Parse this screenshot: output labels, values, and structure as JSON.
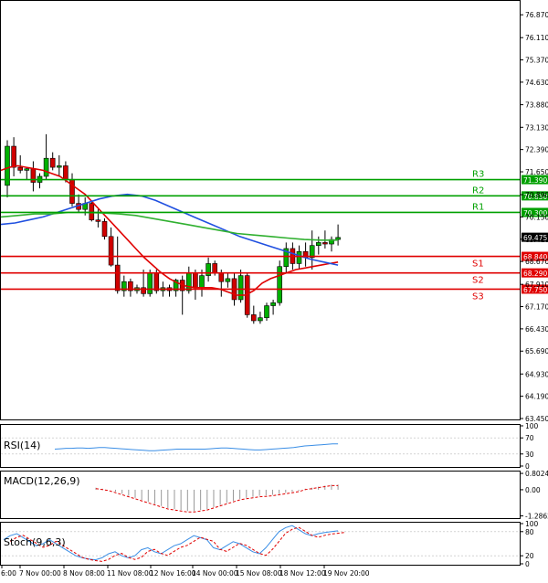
{
  "chart_data": [
    {
      "type": "candlestick",
      "panel": "price",
      "y_ticks": [
        76.87,
        76.11,
        75.37,
        74.63,
        73.88,
        73.13,
        72.39,
        71.65,
        70.89,
        70.15,
        69.41,
        68.67,
        67.91,
        67.17,
        66.43,
        65.69,
        64.93,
        64.19,
        63.45
      ],
      "ylim": [
        63.45,
        77.3
      ],
      "x_labels": [
        "6:00",
        "7 Nov 00:00",
        "8 Nov 08:00",
        "11 Nov 08:00",
        "12 Nov 16:00",
        "14 Nov 00:00",
        "15 Nov 08:00",
        "18 Nov 12:00",
        "19 Nov 20:00"
      ],
      "candles": [
        [
          71.2,
          72.7,
          70.8,
          72.5
        ],
        [
          72.5,
          72.8,
          71.5,
          71.8
        ],
        [
          71.8,
          72.2,
          71.6,
          71.7
        ],
        [
          71.7,
          71.8,
          71.4,
          71.75
        ],
        [
          71.75,
          72.0,
          71.0,
          71.3
        ],
        [
          71.3,
          71.6,
          71.1,
          71.5
        ],
        [
          71.5,
          72.9,
          71.4,
          72.1
        ],
        [
          72.1,
          72.3,
          71.7,
          71.8
        ],
        [
          71.8,
          72.2,
          71.5,
          71.85
        ],
        [
          71.85,
          72.0,
          71.3,
          71.4
        ],
        [
          71.4,
          71.6,
          70.5,
          70.6
        ],
        [
          70.6,
          70.9,
          70.3,
          70.4
        ],
        [
          70.4,
          70.8,
          70.2,
          70.6
        ],
        [
          70.6,
          70.7,
          70.0,
          70.05
        ],
        [
          70.05,
          70.4,
          69.8,
          70.0
        ],
        [
          70.0,
          70.1,
          69.4,
          69.5
        ],
        [
          69.5,
          69.8,
          68.5,
          68.55
        ],
        [
          68.55,
          69.5,
          67.6,
          67.7
        ],
        [
          67.7,
          68.2,
          67.5,
          68.0
        ],
        [
          68.0,
          68.1,
          67.5,
          67.7
        ],
        [
          67.7,
          67.9,
          67.6,
          67.8
        ],
        [
          67.8,
          68.4,
          67.5,
          67.6
        ],
        [
          67.6,
          68.4,
          67.5,
          68.3
        ],
        [
          68.3,
          68.4,
          67.6,
          67.7
        ],
        [
          67.7,
          68.0,
          67.5,
          67.8
        ],
        [
          67.8,
          67.9,
          67.5,
          67.7
        ],
        [
          67.7,
          68.1,
          67.5,
          68.05
        ],
        [
          68.05,
          68.2,
          66.9,
          67.7
        ],
        [
          67.7,
          68.5,
          67.6,
          68.3
        ],
        [
          68.3,
          68.4,
          67.4,
          67.8
        ],
        [
          67.8,
          68.4,
          67.5,
          68.2
        ],
        [
          68.2,
          68.8,
          68.0,
          68.6
        ],
        [
          68.6,
          68.7,
          68.2,
          68.3
        ],
        [
          68.3,
          68.4,
          67.5,
          68.0
        ],
        [
          68.0,
          68.3,
          67.8,
          68.1
        ],
        [
          68.1,
          68.3,
          67.2,
          67.4
        ],
        [
          67.4,
          68.4,
          67.3,
          68.2
        ],
        [
          68.2,
          68.3,
          66.8,
          66.9
        ],
        [
          66.9,
          67.2,
          66.6,
          66.7
        ],
        [
          66.7,
          67.0,
          66.6,
          66.8
        ],
        [
          66.8,
          67.3,
          66.7,
          67.2
        ],
        [
          67.2,
          67.4,
          66.9,
          67.3
        ],
        [
          67.3,
          68.7,
          67.2,
          68.5
        ],
        [
          68.5,
          69.3,
          68.3,
          69.1
        ],
        [
          69.1,
          69.3,
          68.4,
          68.6
        ],
        [
          68.6,
          69.2,
          68.4,
          69.0
        ],
        [
          69.0,
          69.3,
          68.5,
          68.8
        ],
        [
          68.8,
          69.7,
          68.4,
          69.2
        ],
        [
          69.2,
          69.5,
          68.9,
          69.3
        ],
        [
          69.3,
          69.7,
          69.1,
          69.25
        ],
        [
          69.25,
          69.5,
          69.0,
          69.4
        ],
        [
          69.4,
          69.9,
          69.2,
          69.47
        ]
      ],
      "levels": [
        {
          "name": "R3",
          "value": 71.39,
          "color": "#00a000"
        },
        {
          "name": "R2",
          "value": 70.85,
          "color": "#00a000"
        },
        {
          "name": "R1",
          "value": 70.3,
          "color": "#00a000"
        },
        {
          "name": "S1",
          "value": 68.84,
          "color": "#e00000"
        },
        {
          "name": "S2",
          "value": 68.29,
          "color": "#e00000"
        },
        {
          "name": "S3",
          "value": 67.75,
          "color": "#e00000"
        }
      ],
      "level_tags": [
        "71.390",
        "70.850",
        "70.300",
        "68.840",
        "68.290",
        "67.750"
      ],
      "current_price": "69.475",
      "moving_averages": [
        {
          "color": "#e00000",
          "values": [
            71.7,
            71.8,
            71.85,
            71.8,
            71.75,
            71.7,
            71.6,
            71.5,
            71.3,
            71.1,
            70.9,
            70.6,
            70.3,
            70.0,
            69.7,
            69.4,
            69.1,
            68.8,
            68.55,
            68.3,
            68.1,
            67.95,
            67.85,
            67.8,
            67.8,
            67.8,
            67.75,
            67.65,
            67.55,
            67.55,
            67.7,
            67.95,
            68.1,
            68.2,
            68.3,
            68.4,
            68.45,
            68.5,
            68.55,
            68.6,
            68.65
          ]
        },
        {
          "color": "#2050e0",
          "values": [
            69.9,
            69.95,
            70.05,
            70.15,
            70.3,
            70.45,
            70.6,
            70.75,
            70.85,
            70.9,
            70.85,
            70.7,
            70.5,
            70.3,
            70.1,
            69.9,
            69.7,
            69.5,
            69.35,
            69.2,
            69.05,
            68.9,
            68.75,
            68.65,
            68.55
          ]
        },
        {
          "color": "#30b030",
          "values": [
            70.15,
            70.2,
            70.25,
            70.25,
            70.3,
            70.3,
            70.28,
            70.25,
            70.2,
            70.1,
            70.0,
            69.9,
            69.8,
            69.7,
            69.6,
            69.55,
            69.5,
            69.45,
            69.4,
            69.38,
            69.38
          ]
        }
      ]
    },
    {
      "type": "line",
      "panel": "rsi",
      "label": "RSI(14)",
      "y_ticks": [
        "100",
        "70",
        "30",
        "0"
      ],
      "ylim": [
        0,
        100
      ],
      "values": [
        42,
        43,
        44,
        44,
        45,
        45,
        44,
        45,
        46,
        46,
        45,
        44,
        43,
        42,
        41,
        40,
        39,
        38,
        38,
        39,
        40,
        41,
        42,
        42,
        42,
        42,
        42,
        42,
        43,
        44,
        45,
        45,
        44,
        43,
        42,
        41,
        40,
        40,
        41,
        42,
        43,
        44,
        45,
        46,
        48,
        50,
        51,
        52,
        53,
        54,
        55,
        55
      ]
    },
    {
      "type": "histogram",
      "panel": "macd",
      "label": "MACD(12,26,9)",
      "y_ticks": [
        "0.8024",
        "0.00",
        "-1.2862"
      ],
      "ylim": [
        -1.35,
        0.85
      ],
      "values": [
        0.1,
        0.05,
        0.0,
        -0.1,
        -0.2,
        -0.3,
        -0.4,
        -0.5,
        -0.6,
        -0.7,
        -0.8,
        -0.9,
        -0.95,
        -1.0,
        -1.05,
        -1.05,
        -1.0,
        -0.95,
        -0.85,
        -0.75,
        -0.65,
        -0.55,
        -0.45,
        -0.4,
        -0.35,
        -0.3,
        -0.28,
        -0.25,
        -0.2,
        -0.15,
        -0.1,
        -0.05,
        0.05,
        0.1,
        0.15,
        0.2,
        0.25,
        0.25
      ]
    },
    {
      "type": "line",
      "panel": "stoch",
      "label": "Stoch(9,6,3)",
      "y_ticks": [
        "100",
        "80",
        "20",
        "0"
      ],
      "ylim": [
        0,
        100
      ],
      "values": [
        60,
        70,
        75,
        65,
        55,
        45,
        50,
        60,
        50,
        40,
        30,
        20,
        15,
        12,
        10,
        15,
        25,
        30,
        20,
        15,
        20,
        35,
        40,
        30,
        25,
        35,
        45,
        50,
        60,
        70,
        65,
        60,
        40,
        35,
        45,
        55,
        50,
        40,
        30,
        25,
        40,
        60,
        80,
        90,
        95,
        85,
        75,
        70,
        75,
        78,
        80,
        82
      ]
    }
  ]
}
